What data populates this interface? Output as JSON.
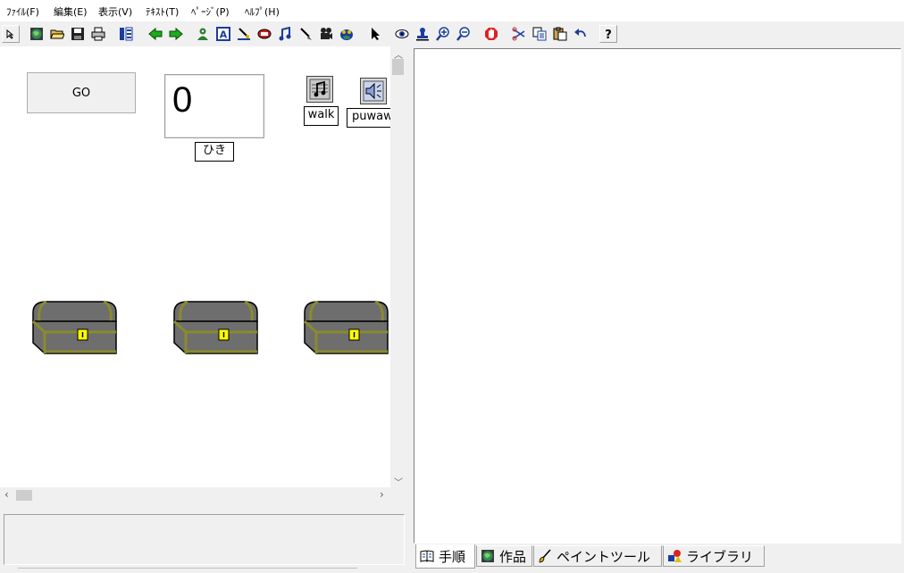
{
  "menu": {
    "items": [
      {
        "label": "ﾌｧｲﾙ(F)"
      },
      {
        "label": "編集(E)"
      },
      {
        "label": "表示(V)"
      },
      {
        "label": "ﾃｷｽﾄ(T)"
      },
      {
        "label": "ﾍﾟｰｼﾞ(P)"
      },
      {
        "label": "ﾍﾙﾌﾟ(H)"
      }
    ]
  },
  "toolbar": {
    "buttons": [
      "pointer-small-icon",
      "globe-icon",
      "open-folder-icon",
      "save-icon",
      "print-icon",
      "layout-icon",
      "back-arrow-icon",
      "forward-arrow-icon",
      "character-icon",
      "text-tool-icon",
      "paint-tool-icon",
      "record-icon",
      "music-icon",
      "brush-icon",
      "movie-icon",
      "frog-icon",
      "arrow-cursor-icon",
      "eye-icon",
      "stamp-icon",
      "zoom-in-icon",
      "zoom-out-icon",
      "stop-icon",
      "cut-icon",
      "copy-icon",
      "paste-icon",
      "undo-icon",
      "help-icon"
    ]
  },
  "stage": {
    "go_button": "GO",
    "counter_value": "0",
    "counter_label": "ひき",
    "sounds": [
      {
        "label": "walk",
        "icon": "music-note-icon"
      },
      {
        "label": "puwaw",
        "icon": "speaker-icon"
      }
    ],
    "chests": [
      "treasure-chest-icon",
      "treasure-chest-icon",
      "treasure-chest-icon"
    ]
  },
  "tabs": [
    {
      "label": "手順",
      "icon": "book-icon",
      "active": true
    },
    {
      "label": "作品",
      "icon": "globe-icon",
      "active": false
    },
    {
      "label": "ペイントツール",
      "icon": "brush-icon",
      "active": false
    },
    {
      "label": "ライブラリ",
      "icon": "shapes-icon",
      "active": false
    }
  ],
  "colors": {
    "chest_body": "#6e6e6e",
    "chest_trim": "#8a8a2e",
    "lock": "#ffff00",
    "panel_bg": "#f0f0f0"
  }
}
